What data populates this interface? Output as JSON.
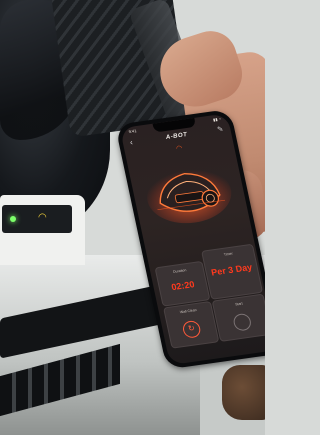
{
  "app": {
    "status_time": "9:41",
    "status_icons": "▮▮ ◔",
    "brand": "A-BOT",
    "back_icon": "back-icon",
    "edit_icon": "edit-icon",
    "wifi_icon": "wifi-icon"
  },
  "cards": {
    "duration": {
      "label": "Duration",
      "value": "02:20"
    },
    "timer": {
      "label": "Timer",
      "value": "Per 3 Day"
    },
    "wall_clean": {
      "label": "Wall Clean",
      "icon": "wall-clean-icon"
    },
    "start": {
      "label": "Start",
      "icon": "power-ring-icon"
    }
  },
  "colors": {
    "accent": "#ff3a1e",
    "screen_bg": "#2a2122",
    "card_bg": "#3a3334",
    "led_green": "#7cff6a"
  }
}
